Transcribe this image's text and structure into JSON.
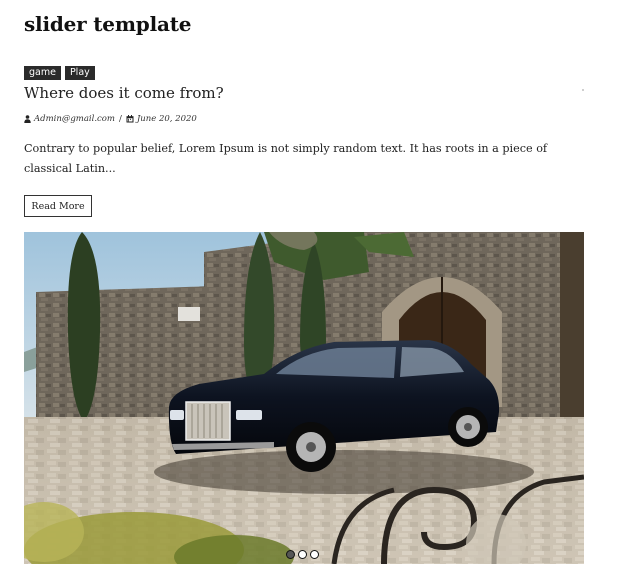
{
  "page": {
    "title": "slider template"
  },
  "post": {
    "tags": [
      "game",
      "Play"
    ],
    "title": "Where does it come from?",
    "author": "Admin@gmail.com",
    "separator": "/",
    "date": "June 20, 2020",
    "excerpt": "Contrary to popular belief, Lorem Ipsum is not simply random text. It has roots in a piece of classical Latin...",
    "read_more_label": "Read More"
  },
  "slider": {
    "image_alt": "black luxury sedan parked in a stone courtyard",
    "dots_count": 3,
    "active_dot": 0
  },
  "icons": {
    "author": "user-icon",
    "date": "calendar-icon"
  }
}
